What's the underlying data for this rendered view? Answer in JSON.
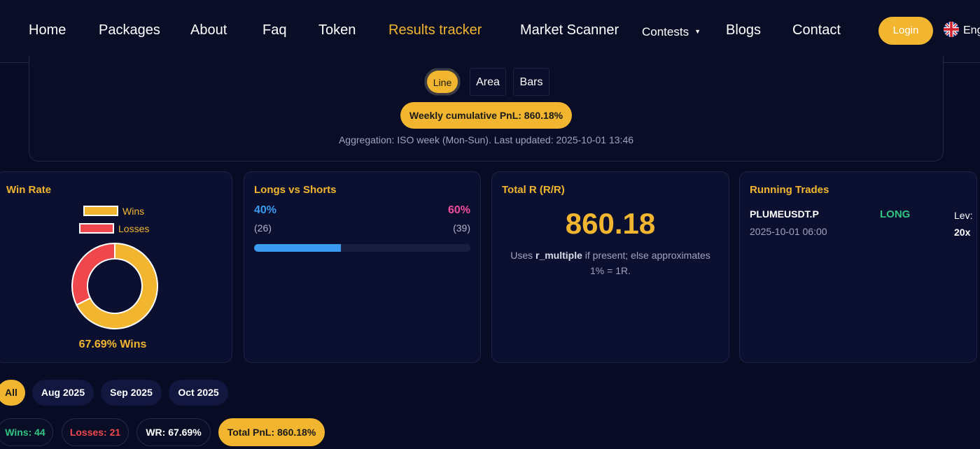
{
  "nav": {
    "items": [
      {
        "label": "Home"
      },
      {
        "label": "Packages"
      },
      {
        "label": "About"
      },
      {
        "label": "Faq"
      },
      {
        "label": "Token"
      },
      {
        "label": "Results tracker",
        "active": true
      },
      {
        "label": "Market Scanner"
      },
      {
        "label": "Contests",
        "dropdown": true
      },
      {
        "label": "Blogs"
      },
      {
        "label": "Contact"
      }
    ],
    "login_label": "Login",
    "language_label": "Eng",
    "language_icon": "uk-flag-icon"
  },
  "chart_panel": {
    "toggles": [
      {
        "label": "Line",
        "active": true
      },
      {
        "label": "Area"
      },
      {
        "label": "Bars"
      }
    ],
    "pnl_pill": "Weekly cumulative PnL: 860.18%",
    "aggregation_note": "Aggregation: ISO week (Mon-Sun). Last updated: 2025-10-01 13:46"
  },
  "win_rate": {
    "title": "Win Rate",
    "legend_wins": "Wins",
    "legend_losses": "Losses",
    "caption": "67.69% Wins",
    "wins_fraction": 0.6769,
    "colors": {
      "wins": "#f1b52f",
      "losses": "#f0474d"
    }
  },
  "chart_data": {
    "type": "pie",
    "categories": [
      "Wins",
      "Losses"
    ],
    "values": [
      44,
      21
    ],
    "title": "Win Rate"
  },
  "longs_shorts": {
    "title": "Longs vs Shorts",
    "long_pct": "40%",
    "short_pct": "60%",
    "long_count": "(26)",
    "short_count": "(39)",
    "long_fraction": 0.4,
    "colors": {
      "long": "#3b9bf0",
      "short": "#f04b9a"
    }
  },
  "total_r": {
    "title": "Total R (R/R)",
    "value": "860.18",
    "note_prefix": "Uses ",
    "note_bold": "r_multiple",
    "note_suffix": " if present; else approximates 1% = 1R."
  },
  "running_trades": {
    "title": "Running Trades",
    "trades": [
      {
        "symbol": "PLUMEUSDT.P",
        "date": "2025-10-01 06:00",
        "side": "LONG",
        "lev_label": "Lev:",
        "lev": "20x"
      }
    ]
  },
  "filters": {
    "months": [
      {
        "label": "All",
        "active": true
      },
      {
        "label": "Aug 2025"
      },
      {
        "label": "Sep 2025"
      },
      {
        "label": "Oct 2025"
      }
    ]
  },
  "stats": {
    "wins": "Wins: 44",
    "losses": "Losses: 21",
    "wr": "WR: 67.69%",
    "total_pnl": "Total PnL: 860.18%",
    "colors": {
      "wins": "#2fc482",
      "losses": "#f0474d"
    }
  }
}
